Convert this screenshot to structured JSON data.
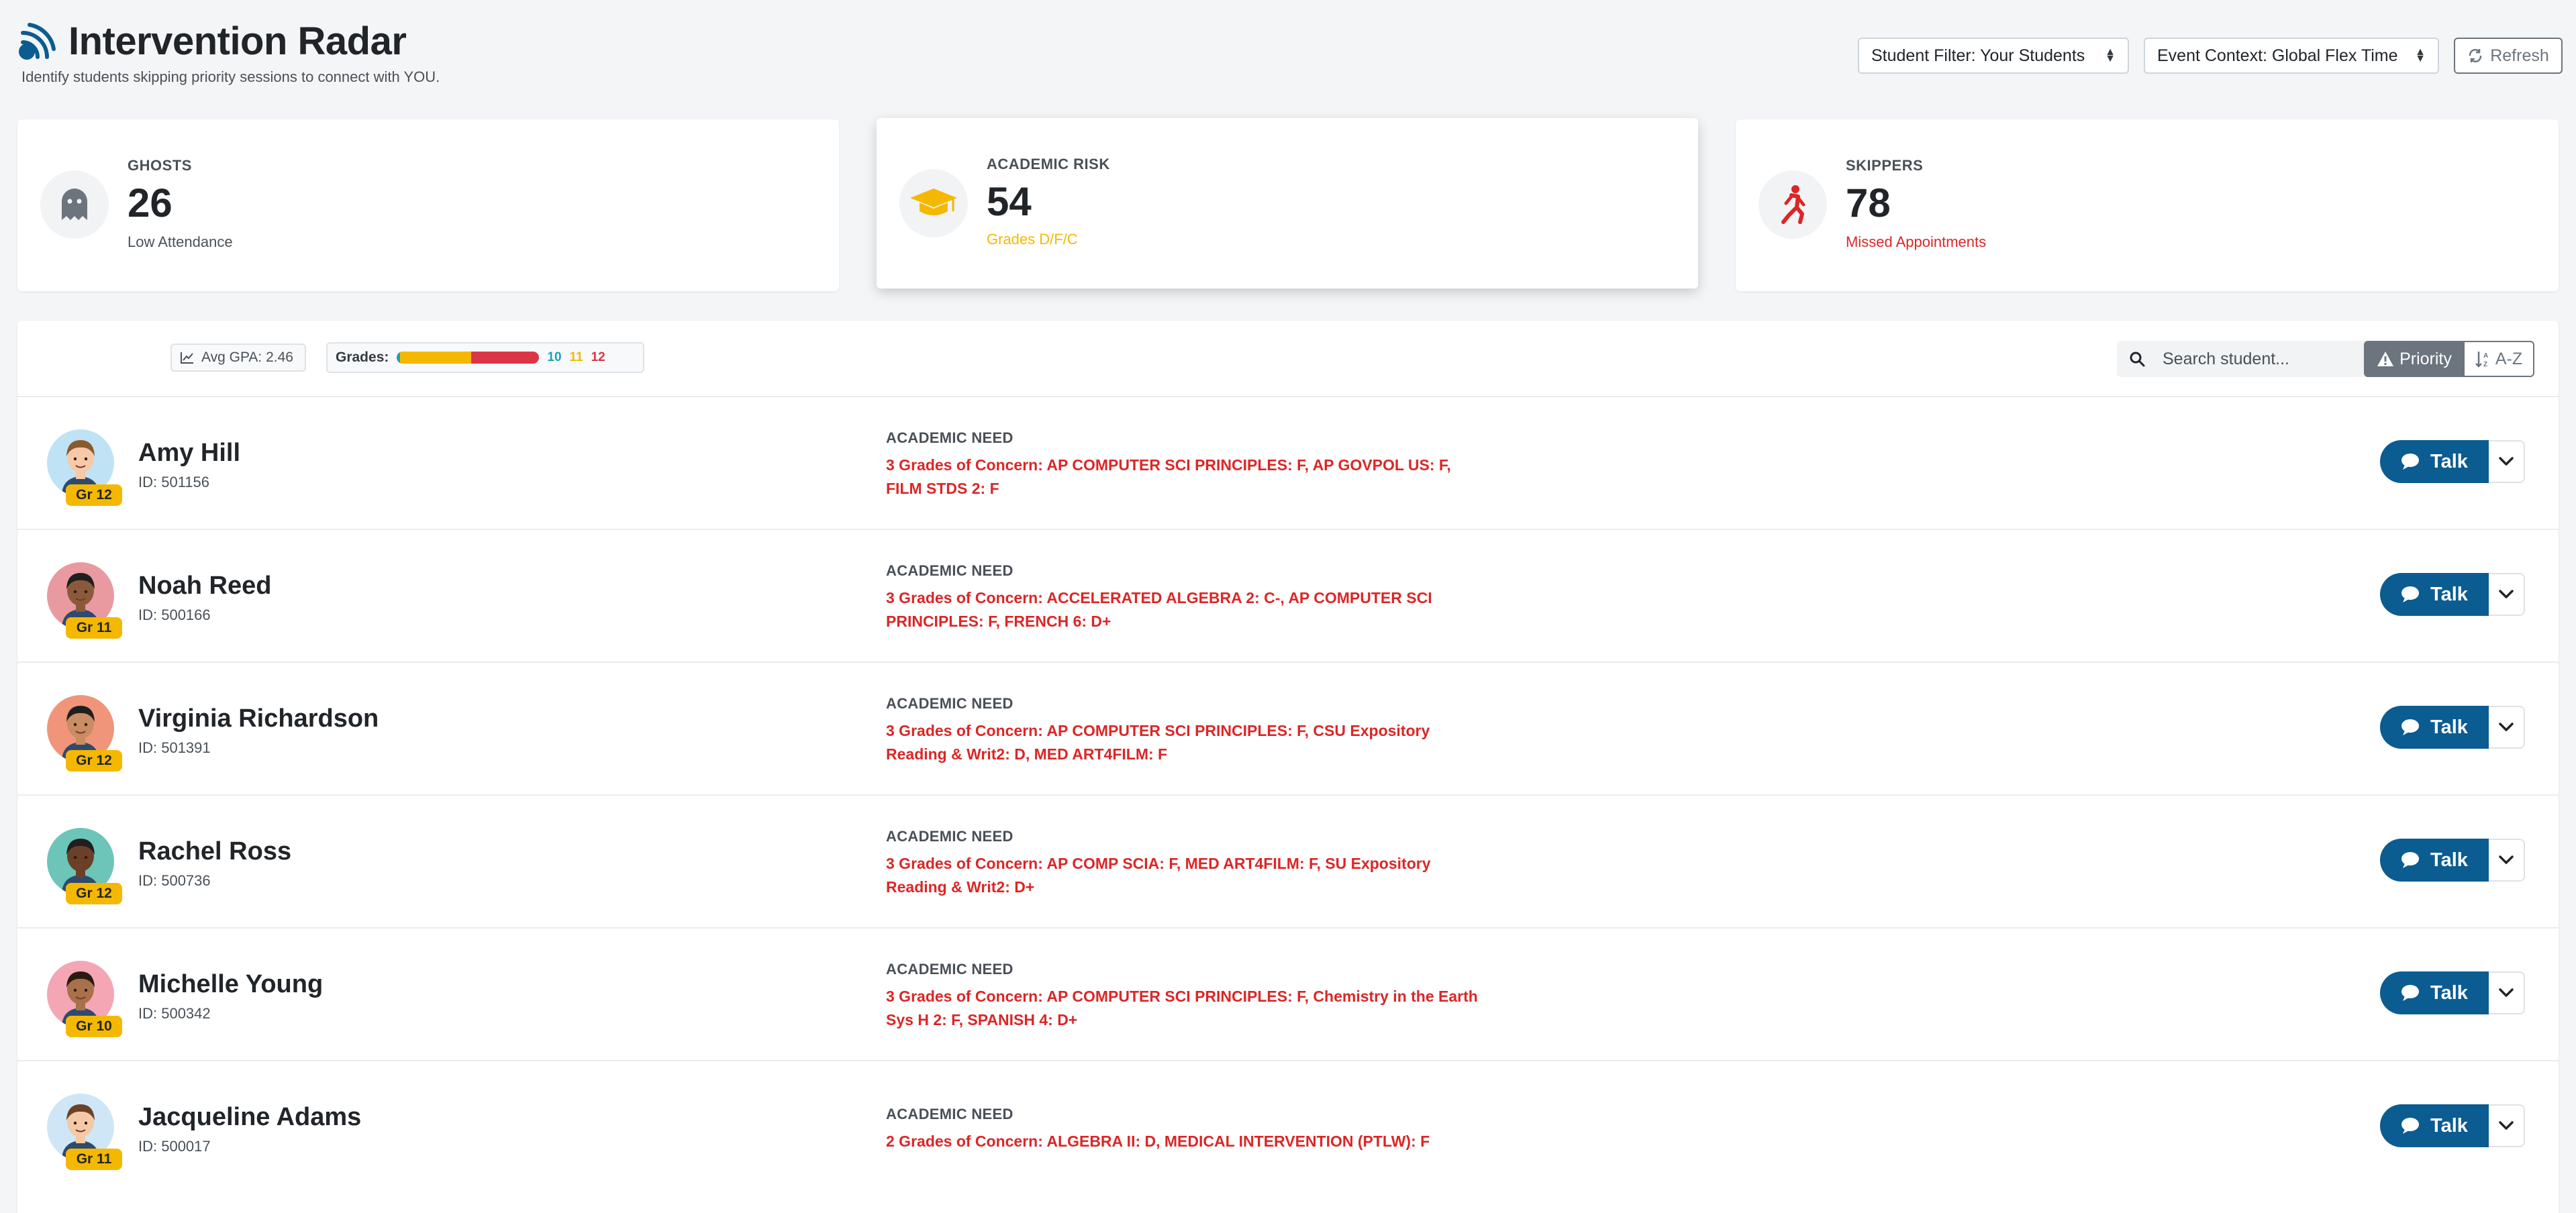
{
  "header": {
    "title": "Intervention Radar",
    "subtitle": "Identify students skipping priority sessions to connect with YOU.",
    "student_filter": "Student Filter: Your Students",
    "event_context": "Event Context: Global Flex Time",
    "refresh_label": "Refresh"
  },
  "stats": {
    "ghosts": {
      "label": "GHOSTS",
      "value": "26",
      "desc": "Low Attendance",
      "desc_color": "#495057",
      "icon": "ghost-icon"
    },
    "academic": {
      "label": "ACADEMIC RISK",
      "value": "54",
      "desc": "Grades D/F/C",
      "desc_color": "#f5b800",
      "icon": "graduation-cap-icon"
    },
    "skippers": {
      "label": "SKIPPERS",
      "value": "78",
      "desc": "Missed Appointments",
      "desc_color": "#dc2626",
      "icon": "running-person-icon"
    }
  },
  "toolbar": {
    "avg_gpa": "Avg GPA: 2.46",
    "grades_label": "Grades:",
    "grade_dist": {
      "g10": 0.02,
      "g11": 0.5,
      "g12": 0.48
    },
    "grade_counts": [
      "10",
      "11",
      "12"
    ],
    "grade_colors": {
      "g10": "#17a2b8",
      "g11": "#f5b800",
      "g12": "#dc3545"
    },
    "search_placeholder": "Search student...",
    "sort_priority": "Priority",
    "sort_az": "A-Z"
  },
  "students": [
    {
      "name": "Amy Hill",
      "id": "ID: 501156",
      "grade": "Gr 12",
      "need_label": "ACADEMIC NEED",
      "need": "3 Grades of Concern: AP COMPUTER SCI PRINCIPLES: F, AP GOVPOL US: F, FILM STDS 2: F",
      "talk": "Talk",
      "avatar_bg": "#bfe3f5",
      "skin": "#f6c9a8",
      "hair": "#8b5a2b"
    },
    {
      "name": "Noah Reed",
      "id": "ID: 500166",
      "grade": "Gr 11",
      "need_label": "ACADEMIC NEED",
      "need": "3 Grades of Concern: ACCELERATED ALGEBRA 2: C-, AP COMPUTER SCI PRINCIPLES: F, FRENCH 6: D+",
      "talk": "Talk",
      "avatar_bg": "#e89aa0",
      "skin": "#8a5a3b",
      "hair": "#1f1f1f"
    },
    {
      "name": "Virginia Richardson",
      "id": "ID: 501391",
      "grade": "Gr 12",
      "need_label": "ACADEMIC NEED",
      "need": "3 Grades of Concern: AP COMPUTER SCI PRINCIPLES: F, CSU Expository Reading & Writ2: D, MED ART4FILM: F",
      "talk": "Talk",
      "avatar_bg": "#f0957a",
      "skin": "#c98c63",
      "hair": "#1f1f1f"
    },
    {
      "name": "Rachel Ross",
      "id": "ID: 500736",
      "grade": "Gr 12",
      "need_label": "ACADEMIC NEED",
      "need": "3 Grades of Concern: AP COMP SCIA: F, MED ART4FILM: F, SU Expository Reading & Writ2: D+",
      "talk": "Talk",
      "avatar_bg": "#6cc5b8",
      "skin": "#6b4028",
      "hair": "#1f1f1f"
    },
    {
      "name": "Michelle Young",
      "id": "ID: 500342",
      "grade": "Gr 10",
      "need_label": "ACADEMIC NEED",
      "need": "3 Grades of Concern: AP COMPUTER SCI PRINCIPLES: F, Chemistry in the Earth Sys H 2: F, SPANISH 4: D+",
      "talk": "Talk",
      "avatar_bg": "#f4a6b4",
      "skin": "#a8714c",
      "hair": "#2a1a12"
    },
    {
      "name": "Jacqueline Adams",
      "id": "ID: 500017",
      "grade": "Gr 11",
      "need_label": "ACADEMIC NEED",
      "need": "2 Grades of Concern: ALGEBRA II: D, MEDICAL INTERVENTION (PTLW): F",
      "talk": "Talk",
      "avatar_bg": "#cfe6f7",
      "skin": "#f3c9a6",
      "hair": "#6b4226"
    }
  ]
}
